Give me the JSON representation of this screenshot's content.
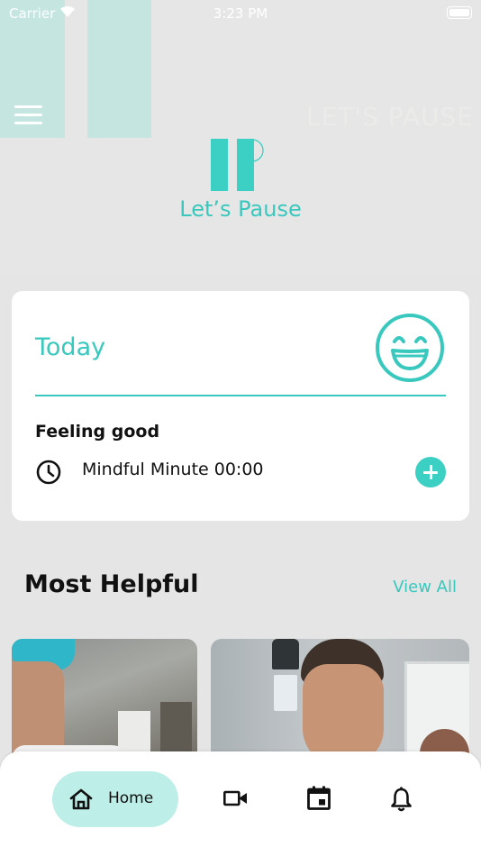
{
  "status_bar": {
    "carrier": "Carrier",
    "time": "3:23 PM"
  },
  "header": {
    "watermark": "LET'S PAUSE",
    "logo_name": "Let’s Pause"
  },
  "today_card": {
    "title": "Today",
    "mood": "Feeling good",
    "mindful_label": "Mindful Minute 00:00"
  },
  "most_helpful": {
    "title": "Most Helpful",
    "view_all": "View All"
  },
  "tab_bar": {
    "home_label": "Home"
  },
  "colors": {
    "accent": "#39c8be",
    "accent_light": "#bdeee7",
    "header_decor": "#c5e6e0",
    "background": "#e4e5e4"
  },
  "icons": [
    "menu-icon",
    "smiley-icon",
    "clock-icon",
    "add-icon",
    "home-icon",
    "video-camera-icon",
    "calendar-icon",
    "bell-icon"
  ]
}
